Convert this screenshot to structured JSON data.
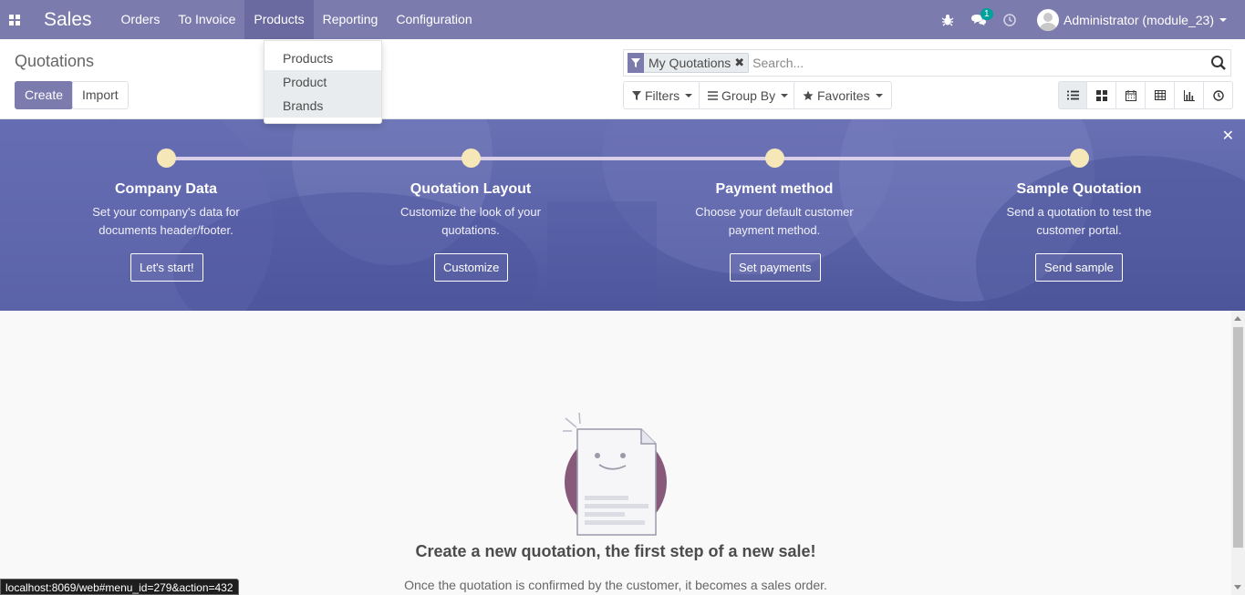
{
  "navbar": {
    "app_name": "Sales",
    "menu": [
      "Orders",
      "To Invoice",
      "Products",
      "Reporting",
      "Configuration"
    ],
    "active_menu": "Products",
    "message_count": "1",
    "user": "Administrator (module_23)"
  },
  "products_dropdown": {
    "items": [
      "Products",
      "Product Brands"
    ],
    "hovered": "Product Brands"
  },
  "control_panel": {
    "breadcrumb": "Quotations",
    "create_label": "Create",
    "import_label": "Import",
    "facet_label": "My Quotations",
    "search_placeholder": "Search...",
    "filters_label": "Filters",
    "groupby_label": "Group By",
    "favorites_label": "Favorites",
    "views": [
      "list-view-icon",
      "kanban-view-icon",
      "calendar-view-icon",
      "pivot-view-icon",
      "graph-view-icon",
      "activity-view-icon"
    ],
    "active_view": "list"
  },
  "onboarding": {
    "steps": [
      {
        "title": "Company Data",
        "description": "Set your company's data for documents header/footer.",
        "button": "Let's start!"
      },
      {
        "title": "Quotation Layout",
        "description": "Customize the look of your quotations.",
        "button": "Customize"
      },
      {
        "title": "Payment method",
        "description": "Choose your default customer payment method.",
        "button": "Set payments"
      },
      {
        "title": "Sample Quotation",
        "description": "Send a quotation to test the customer portal.",
        "button": "Send sample"
      }
    ]
  },
  "empty_state": {
    "title": "Create a new quotation, the first step of a new sale!",
    "subtitle": "Once the quotation is confirmed by the customer, it becomes a sales order."
  },
  "status_url": "localhost:8069/web#menu_id=279&action=432",
  "colors": {
    "brand": "#7c7bad",
    "banner": "#5a62a8",
    "step_dot": "#f6e7b8",
    "badge": "#00a09d",
    "illustration_circle": "#875a7b"
  }
}
